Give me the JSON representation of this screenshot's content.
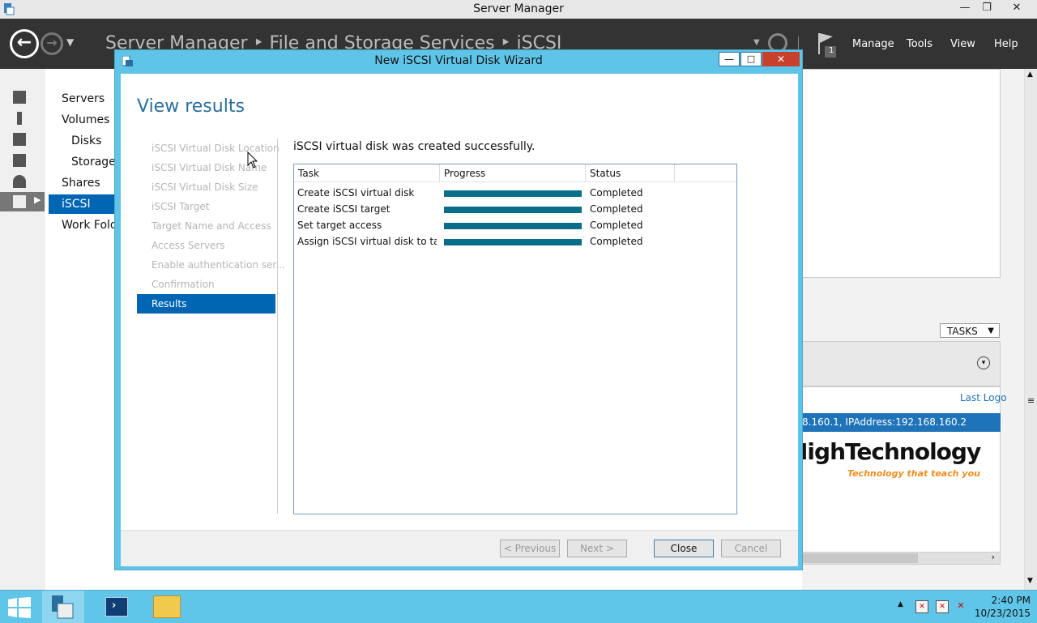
{
  "server_manager": {
    "title": "Server Manager",
    "breadcrumb": "Server Manager ‣ File and Storage Services ‣ iSCSI",
    "menu": [
      "Manage",
      "Tools",
      "View",
      "Help"
    ],
    "flag_count": "1",
    "subnav": [
      "Servers",
      "Volumes",
      "Disks",
      "Storage",
      "Shares",
      "iSCSI",
      "Work Fold"
    ],
    "tasks_label": "TASKS",
    "last_logon": "Last Logo",
    "ip_row": "8.160.1, IPAddress:192.168.160.2"
  },
  "wizard": {
    "title": "New iSCSI Virtual Disk Wizard",
    "heading": "View results",
    "steps": [
      "iSCSI Virtual Disk Location",
      "iSCSI Virtual Disk Name",
      "iSCSI Virtual Disk Size",
      "iSCSI Target",
      "Target Name and Access",
      "Access Servers",
      "Enable authentication ser...",
      "Confirmation",
      "Results"
    ],
    "result_message": "iSCSI virtual disk was created successfully.",
    "columns": [
      "Task",
      "Progress",
      "Status"
    ],
    "rows": [
      {
        "task": "Create iSCSI virtual disk",
        "progress": 1.0,
        "status": "Completed"
      },
      {
        "task": "Create iSCSI target",
        "progress": 1.0,
        "status": "Completed"
      },
      {
        "task": "Set target access",
        "progress": 1.0,
        "status": "Completed"
      },
      {
        "task": "Assign iSCSI virtual disk to target",
        "progress": 1.0,
        "status": "Completed"
      }
    ],
    "buttons": {
      "previous": "< Previous",
      "next": "Next >",
      "close": "Close",
      "cancel": "Cancel"
    }
  },
  "watermark": {
    "brand": "HighTechnology",
    "tagline": "Technology that teach you"
  },
  "taskbar": {
    "time": "2:40 PM",
    "date": "10/23/2015"
  },
  "colors": {
    "accent": "#0066b3",
    "progress": "#0a6e8a",
    "window_frame": "#5ec5e8",
    "header": "#333333"
  }
}
